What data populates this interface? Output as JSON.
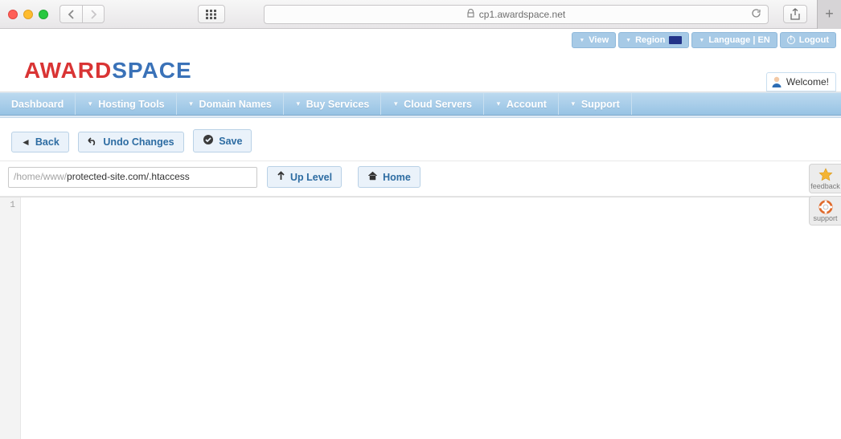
{
  "browser": {
    "url_host": "cp1.awardspace.net"
  },
  "account_bar": {
    "view": "View",
    "region": "Region",
    "language": "Language | EN",
    "logout": "Logout"
  },
  "logo": {
    "part1": "AWARD",
    "part2": "SPACE"
  },
  "welcome": "Welcome!",
  "nav": {
    "dashboard": "Dashboard",
    "hosting": "Hosting Tools",
    "domains": "Domain Names",
    "buy": "Buy Services",
    "cloud": "Cloud Servers",
    "account": "Account",
    "support": "Support"
  },
  "toolbar": {
    "back": "Back",
    "undo": "Undo Changes",
    "save": "Save",
    "uplevel": "Up Level",
    "home": "Home"
  },
  "path": {
    "prefix": "/home/www/",
    "rest": "protected-site.com/.htaccess",
    "full": "/home/www/protected-site.com/.htaccess"
  },
  "editor": {
    "line_numbers": [
      "1"
    ],
    "content": ""
  },
  "side": {
    "feedback": "feedback",
    "support": "support"
  }
}
